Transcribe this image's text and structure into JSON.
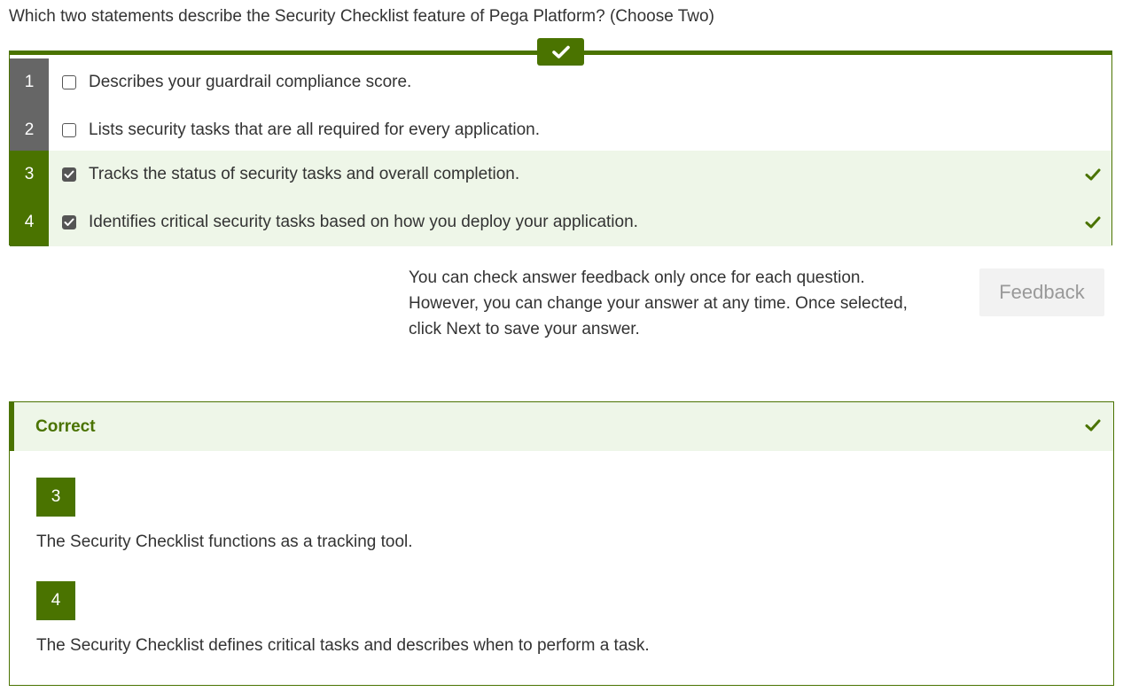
{
  "question": {
    "text": "Which two statements describe the Security Checklist feature of Pega Platform? (Choose Two)"
  },
  "check_tab": {
    "icon": "check-icon"
  },
  "options": [
    {
      "number": "1",
      "text": "Describes your guardrail compliance score.",
      "checked": false,
      "correct": false
    },
    {
      "number": "2",
      "text": "Lists security tasks that are all required for every application.",
      "checked": false,
      "correct": false
    },
    {
      "number": "3",
      "text": "Tracks the status of security tasks and overall completion.",
      "checked": true,
      "correct": true
    },
    {
      "number": "4",
      "text": "Identifies critical security tasks based on how you deploy your application.",
      "checked": true,
      "correct": true
    }
  ],
  "info": {
    "line1": "You can check answer feedback only once for each question.",
    "line2": "However, you can change your answer at any time. Once selected,",
    "line3": "click Next to save your answer."
  },
  "feedback_button": {
    "label": "Feedback"
  },
  "result": {
    "title": "Correct",
    "answers": [
      {
        "number": "3",
        "explanation": "The Security Checklist functions as a tracking tool."
      },
      {
        "number": "4",
        "explanation": "The Security Checklist defines critical tasks and describes when to perform a task."
      }
    ]
  },
  "colors": {
    "accent_green": "#4a7300",
    "correct_bg": "#eef6e8",
    "neutral_num_bg": "#666666",
    "feedback_disabled_bg": "#f2f2f2"
  }
}
